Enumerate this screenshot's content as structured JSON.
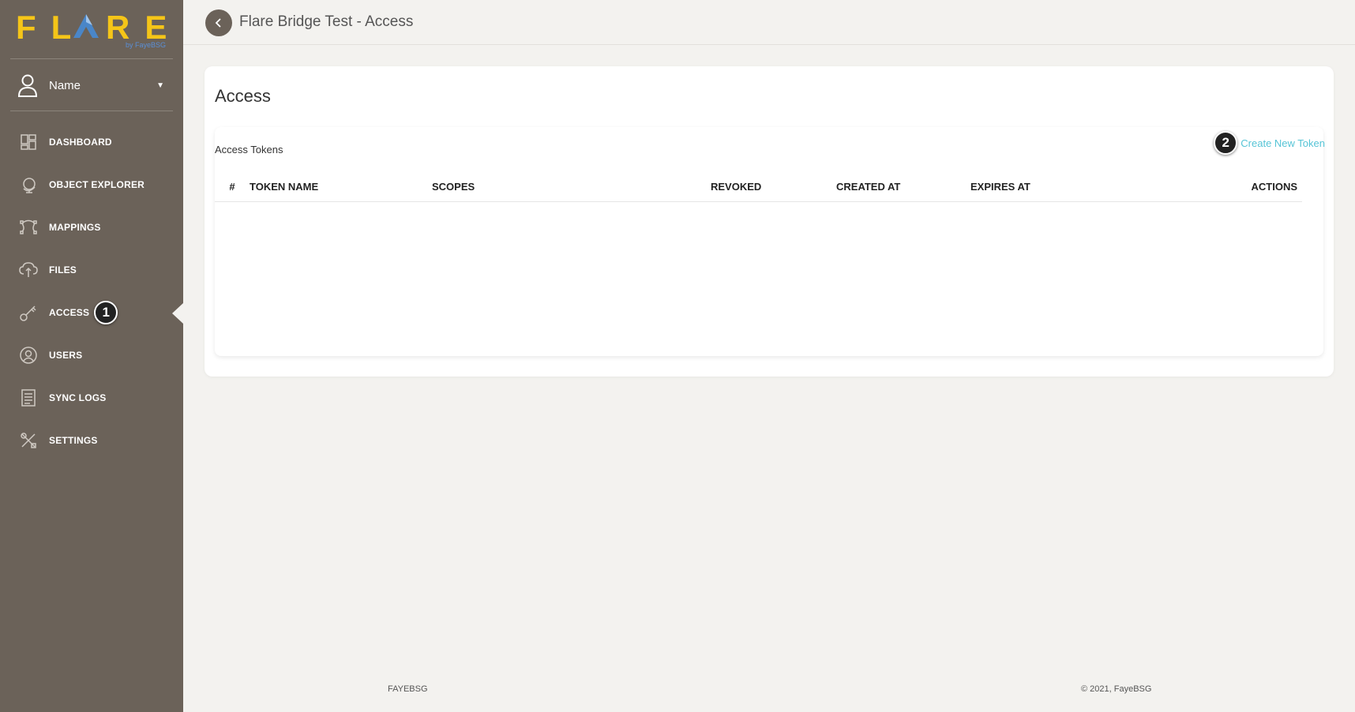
{
  "logo": {
    "word_left": "FL",
    "word_right": "RE",
    "subtitle": "by FayeBSG"
  },
  "user": {
    "name": "Name"
  },
  "nav": {
    "items": [
      {
        "label": "DASHBOARD"
      },
      {
        "label": "OBJECT EXPLORER"
      },
      {
        "label": "MAPPINGS"
      },
      {
        "label": "FILES"
      },
      {
        "label": "ACCESS",
        "active": true,
        "badge": "1"
      },
      {
        "label": "USERS"
      },
      {
        "label": "SYNC LOGS"
      },
      {
        "label": "SETTINGS"
      }
    ]
  },
  "header": {
    "title": "Flare Bridge Test - Access"
  },
  "main": {
    "title": "Access",
    "section_label": "Access Tokens",
    "create_badge": "2",
    "create_label": "Create New Token",
    "columns": [
      "#",
      "TOKEN NAME",
      "SCOPES",
      "REVOKED",
      "CREATED AT",
      "EXPIRES AT",
      "ACTIONS"
    ]
  },
  "footer": {
    "left": "FAYEBSG",
    "right": "© 2021, FayeBSG"
  },
  "colors": {
    "sidebar": "#6b6259",
    "logo": "#f5c518",
    "link": "#56c4d6"
  }
}
